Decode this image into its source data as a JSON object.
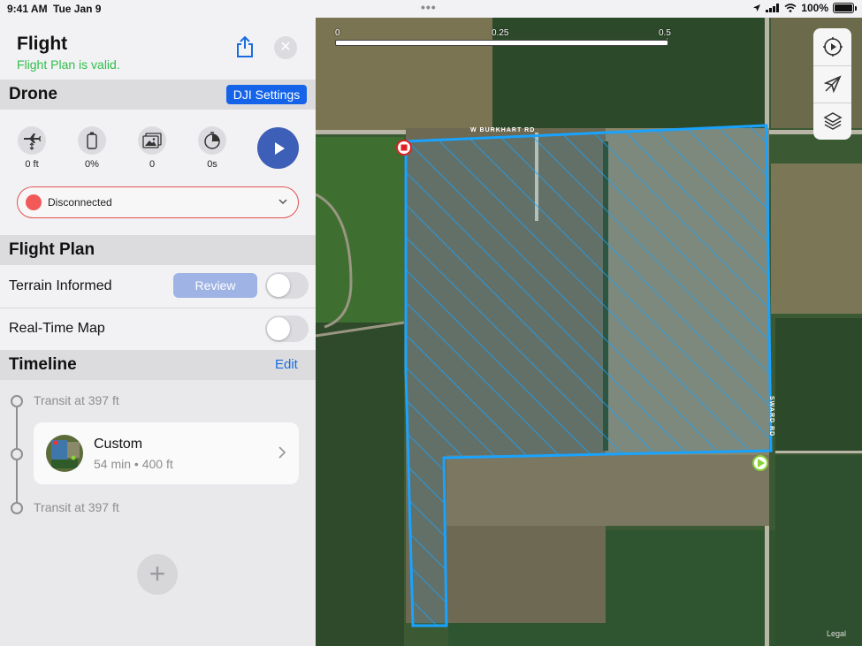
{
  "status_bar": {
    "time": "9:41 AM",
    "date": "Tue Jan 9",
    "battery": "100%"
  },
  "header": {
    "title": "Flight",
    "subtitle": "Flight Plan is valid.",
    "share_icon": "share-icon",
    "close_icon": "close-icon"
  },
  "drone": {
    "section_title": "Drone",
    "dji_settings_label": "DJI Settings",
    "stats": [
      {
        "icon": "altitude-icon",
        "value": "0 ft"
      },
      {
        "icon": "battery-icon",
        "value": "0%"
      },
      {
        "icon": "photos-icon",
        "value": "0"
      },
      {
        "icon": "timer-icon",
        "value": "0s"
      }
    ],
    "play_icon": "play-icon",
    "connection": {
      "status": "Disconnected",
      "status_color": "#f25a5a"
    }
  },
  "flight_plan": {
    "section_title": "Flight Plan",
    "terrain_informed_label": "Terrain Informed",
    "review_label": "Review",
    "terrain_informed_on": false,
    "real_time_map_label": "Real-Time Map",
    "real_time_map_on": false
  },
  "timeline": {
    "section_title": "Timeline",
    "edit_label": "Edit",
    "items": [
      {
        "type": "transit",
        "label": "Transit at 397 ft"
      },
      {
        "type": "mission",
        "name": "Custom",
        "detail": "54 min • 400 ft"
      },
      {
        "type": "transit",
        "label": "Transit at 397 ft"
      }
    ],
    "add_icon": "plus-icon"
  },
  "map": {
    "scale_labels": [
      "0",
      "0.25",
      "0.5 mi"
    ],
    "road_labels": [
      "W BURKHART RD",
      "SWARD RD"
    ],
    "legal": "Legal",
    "controls": [
      "flight-settings-icon",
      "location-arrow-icon",
      "layers-icon"
    ],
    "accent_color": "#1aa3ff"
  }
}
